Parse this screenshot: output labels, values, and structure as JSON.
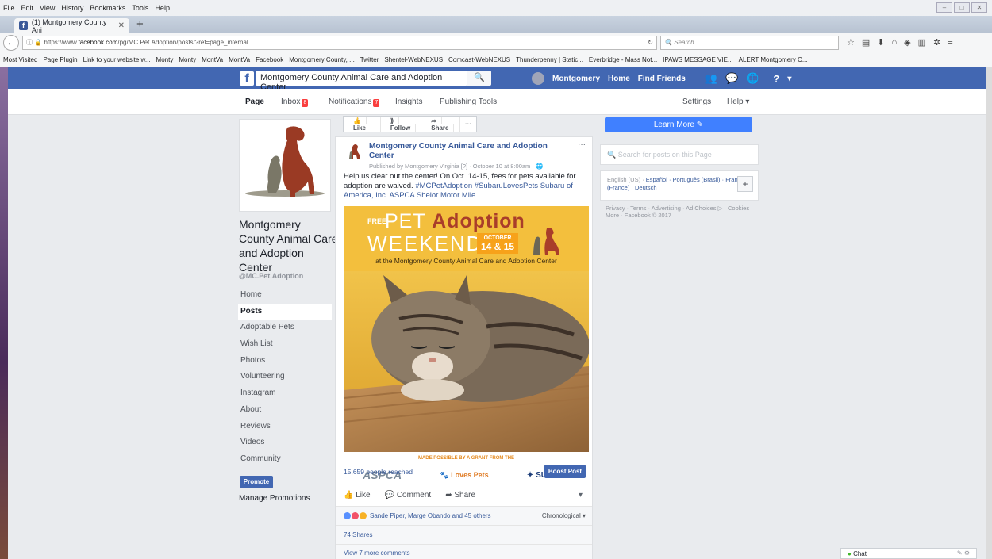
{
  "browser": {
    "menu": [
      "File",
      "Edit",
      "View",
      "History",
      "Bookmarks",
      "Tools",
      "Help"
    ],
    "tab_title": "(1) Montgomery County Ani",
    "url_prefix": "https://www.",
    "url_host": "facebook.com",
    "url_path": "/pg/MC.Pet.Adoption/posts/?ref=page_internal",
    "search_placeholder": "Search",
    "bookmarks": [
      "Most Visited",
      "Page Plugin",
      "Link to your website w...",
      "Monty",
      "Monty",
      "MontVa",
      "MontVa",
      "Facebook",
      "Montgomery County, ...",
      "Twitter",
      "Shentel-WebNEXUS",
      "Comcast-WebNEXUS",
      "Thunderpenny | Static...",
      "Everbridge - Mass Not...",
      "IPAWS MESSAGE VIE...",
      "ALERT Montgomery C..."
    ]
  },
  "fb": {
    "search_value": "Montgomery County Animal Care and Adoption Center",
    "user": "Montgomery",
    "nav_home": "Home",
    "nav_find_friends": "Find Friends"
  },
  "page_nav": {
    "page": "Page",
    "inbox": "Inbox",
    "inbox_count": "8",
    "notifications": "Notifications",
    "notifications_count": "7",
    "insights": "Insights",
    "publishing_tools": "Publishing Tools",
    "settings": "Settings",
    "help": "Help ▾"
  },
  "page": {
    "name": "Montgomery County Animal Care and Adoption Center",
    "handle": "@MC.Pet.Adoption",
    "nav": [
      "Home",
      "Posts",
      "Adoptable Pets",
      "Wish List",
      "Photos",
      "Volunteering",
      "Instagram",
      "About",
      "Reviews",
      "Videos",
      "Community"
    ],
    "promote": "Promote",
    "manage_promotions": "Manage Promotions"
  },
  "actions": {
    "like": "Like",
    "follow": "Follow",
    "share": "Share",
    "more": "···"
  },
  "post": {
    "author": "Montgomery County Animal Care and Adoption Center",
    "meta": "Published by Montgomery Virginia [?] · October 10 at 8:00am · ",
    "text_start": "Help us clear out the center! On Oct. 14-15, fees for pets available for adoption are waived. ",
    "hashtags": "#MCPetAdoption #SubaruLovesPets",
    "text_tags": " Subaru of America, Inc. ASPCA Shelor Motor Mile",
    "flyer": {
      "free": "FREE",
      "pet": "PET",
      "adoption": "Adoption",
      "weekend": "WEEKEND",
      "month": "OCTOBER",
      "days": "14 & 15",
      "sub": "at the Montgomery County Animal Care and Adoption Center",
      "made_by": "MADE POSSIBLE BY A GRANT FROM THE",
      "aspca": "ASPCA",
      "loves_pets": "Loves Pets",
      "subaru": "SUBARU"
    },
    "reached": "15,659 people reached",
    "boost": "Boost Post",
    "like": "Like",
    "comment": "Comment",
    "share": "Share",
    "reactions": "Sande Piper, Marge Obando and 45 others",
    "order": "Chronological ▾",
    "shares": "74 Shares",
    "more_comments": "View 7 more comments"
  },
  "right": {
    "learn_more": "Learn More ✎",
    "search_posts": "Search for posts on this Page",
    "lang_current": "English (US) · ",
    "langs": "Español · Português (Brasil) · Français (France) · Deutsch",
    "footer": "Privacy · Terms · Advertising · Ad Choices ▷ · Cookies · More · Facebook © 2017"
  },
  "chat": {
    "label": "Chat"
  },
  "colors": {
    "fb_blue": "#4267b2",
    "link": "#365899",
    "badge": "#fa3e3e",
    "flyer_bg": "#f3bf3d"
  }
}
